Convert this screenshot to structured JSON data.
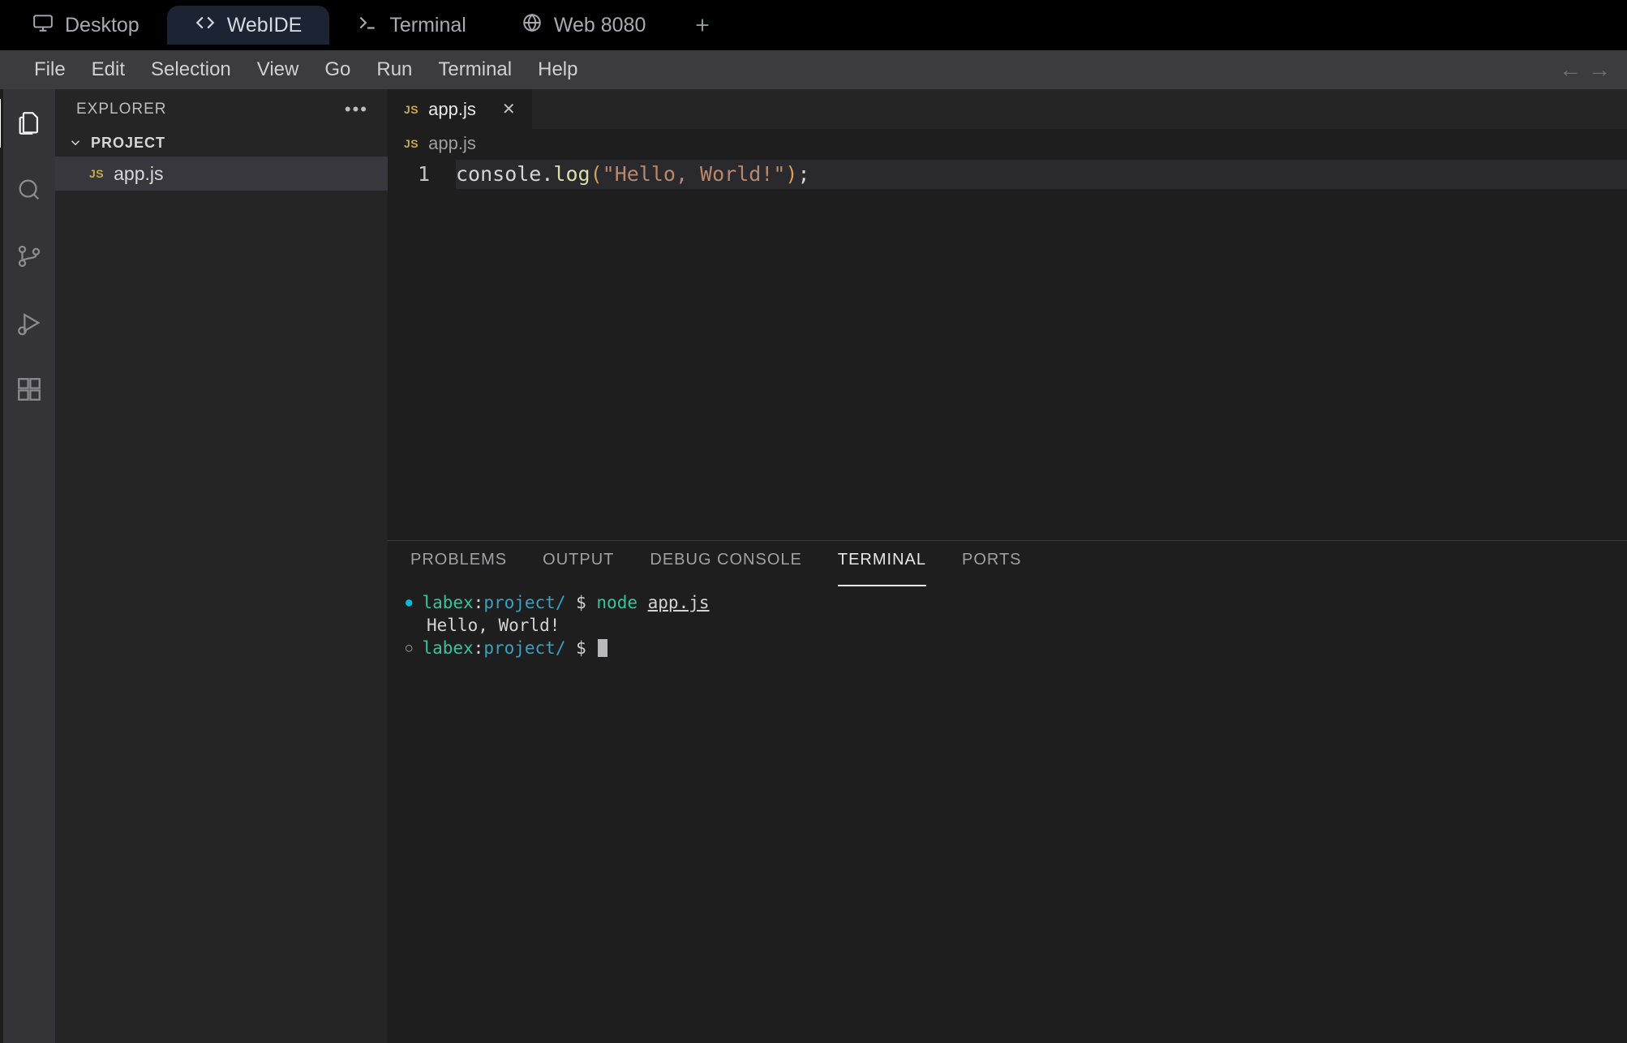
{
  "topTabs": {
    "desktop": "Desktop",
    "webide": "WebIDE",
    "terminal": "Terminal",
    "web8080": "Web 8080"
  },
  "menu": {
    "file": "File",
    "edit": "Edit",
    "selection": "Selection",
    "view": "View",
    "go": "Go",
    "run": "Run",
    "terminal": "Terminal",
    "help": "Help"
  },
  "sidebar": {
    "title": "EXPLORER",
    "project": "PROJECT",
    "file": "app.js",
    "jsBadge": "JS"
  },
  "editor": {
    "tab": {
      "jsBadge": "JS",
      "name": "app.js"
    },
    "breadcrumb": {
      "jsBadge": "JS",
      "name": "app.js"
    },
    "lineNumber": "1",
    "code": {
      "p0": "console",
      "p1": ".",
      "p2": "log",
      "p3": "(",
      "p4": "\"Hello, World!\"",
      "p5": ")",
      "p6": ";"
    }
  },
  "panel": {
    "tabs": {
      "problems": "PROBLEMS",
      "output": "OUTPUT",
      "debug": "DEBUG CONSOLE",
      "terminal": "TERMINAL",
      "ports": "PORTS"
    },
    "term": {
      "user": "labex",
      "colon": ":",
      "path": "project/",
      "prompt": " $ ",
      "cmd_node": "node",
      "cmd_sp": " ",
      "cmd_arg": "app.js",
      "output": "Hello, World!"
    }
  }
}
